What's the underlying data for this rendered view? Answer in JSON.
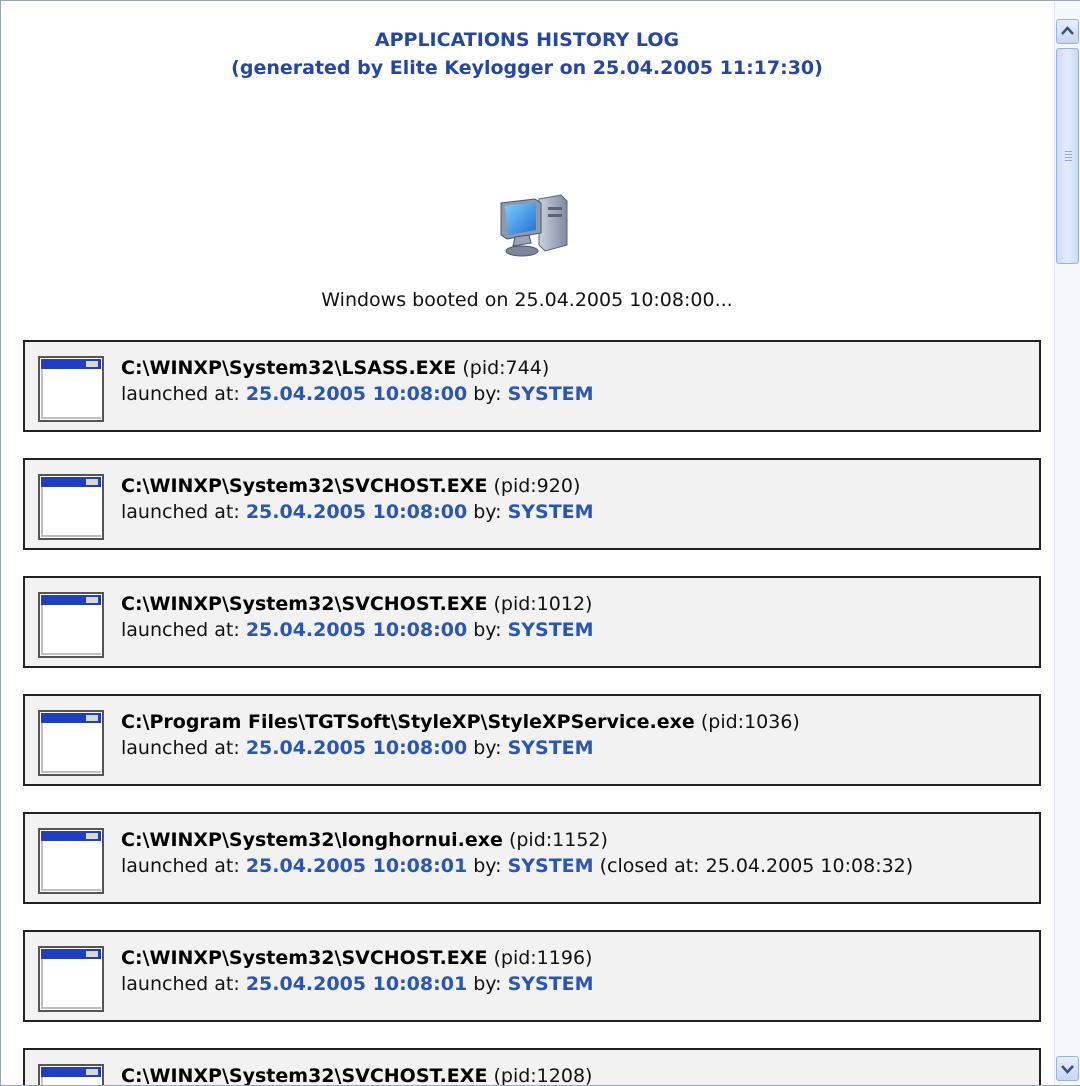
{
  "header": {
    "title": "APPLICATIONS HISTORY LOG",
    "subtitle": "(generated by Elite Keylogger on 25.04.2005 11:17:30)"
  },
  "boot": {
    "icon": "computer-icon",
    "text": "Windows booted on 25.04.2005 10:08:00..."
  },
  "labels": {
    "launched_at": "launched at:",
    "by": "by:"
  },
  "entries": [
    {
      "path": "C:\\WINXP\\System32\\LSASS.EXE",
      "pid": "(pid:744)",
      "time": "25.04.2005 10:08:00",
      "user": "SYSTEM",
      "closed": ""
    },
    {
      "path": "C:\\WINXP\\System32\\SVCHOST.EXE",
      "pid": "(pid:920)",
      "time": "25.04.2005 10:08:00",
      "user": "SYSTEM",
      "closed": ""
    },
    {
      "path": "C:\\WINXP\\System32\\SVCHOST.EXE",
      "pid": "(pid:1012)",
      "time": "25.04.2005 10:08:00",
      "user": "SYSTEM",
      "closed": ""
    },
    {
      "path": "C:\\Program Files\\TGTSoft\\StyleXP\\StyleXPService.exe",
      "pid": "(pid:1036)",
      "time": "25.04.2005 10:08:00",
      "user": "SYSTEM",
      "closed": ""
    },
    {
      "path": "C:\\WINXP\\System32\\longhornui.exe",
      "pid": "(pid:1152)",
      "time": "25.04.2005 10:08:01",
      "user": "SYSTEM",
      "closed": "(closed at: 25.04.2005 10:08:32)"
    },
    {
      "path": "C:\\WINXP\\System32\\SVCHOST.EXE",
      "pid": "(pid:1196)",
      "time": "25.04.2005 10:08:01",
      "user": "SYSTEM",
      "closed": ""
    },
    {
      "path": "C:\\WINXP\\System32\\SVCHOST.EXE",
      "pid": "(pid:1208)",
      "time": "",
      "user": "",
      "closed": ""
    }
  ],
  "colors": {
    "accent": "#2447a3",
    "link": "#2a56b8",
    "entry_bg": "#f2f2f2"
  },
  "scrollbar": {
    "position_fraction": 0.0
  }
}
